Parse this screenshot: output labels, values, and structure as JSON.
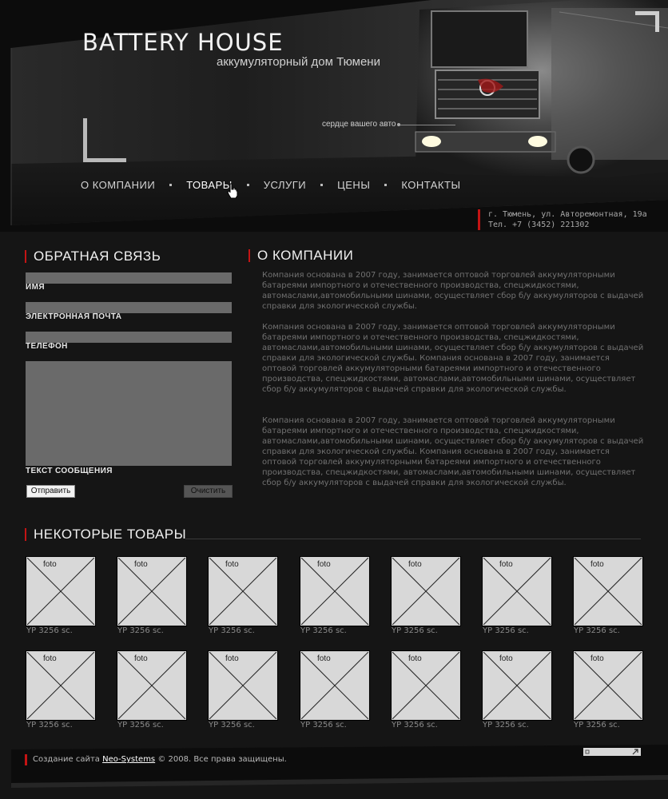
{
  "header": {
    "brand_title": "BATTERY HOUSE",
    "brand_subtitle": "аккумуляторный дом Тюмени",
    "heart_label": "сердце вашего авто"
  },
  "nav": {
    "items": [
      {
        "label": "О КОМПАНИИ",
        "active": false
      },
      {
        "label": "ТОВАРЫ",
        "active": true
      },
      {
        "label": "УСЛУГИ",
        "active": false
      },
      {
        "label": "ЦЕНЫ",
        "active": false
      },
      {
        "label": "КОНТАКТЫ",
        "active": false
      }
    ]
  },
  "contact": {
    "address": "г. Тюмень, ул. Авторемонтная, 19а",
    "phone": "Тел. +7 (3452) 221302"
  },
  "feedback": {
    "heading": "ОБРАТНАЯ СВЯЗЬ",
    "name_label": "ИМЯ",
    "email_label": "ЭЛЕКТРОННАЯ ПОЧТА",
    "phone_label": "ТЕЛЕФОН",
    "message_label": "ТЕКСТ СООБЩЕНИЯ",
    "submit_label": "Отправить",
    "clear_label": "Очистить"
  },
  "about": {
    "heading": "О КОМПАНИИ",
    "paragraphs": [
      "Компания основана в 2007 году, занимается оптовой торговлей аккумуляторными батареями импортного и отечественного производства, спецжидкостями, автомаслами,автомобильными шинами, осуществляет сбор б/у аккумуляторов с выдачей справки для экологической службы.",
      "Компания основана в 2007 году, занимается оптовой торговлей аккумуляторными батареями импортного и отечественного производства, спецжидкостями, автомаслами,автомобильными шинами, осуществляет сбор б/у аккумуляторов с выдачей справки для экологической службы. Компания основана в 2007 году, занимается оптовой торговлей аккумуляторными батареями импортного и отечественного производства, спецжидкостями, автомаслами,автомобильными шинами, осуществляет сбор б/у аккумуляторов с выдачей справки для экологической службы.",
      "Компания основана в 2007 году, занимается оптовой торговлей аккумуляторными батареями импортного и отечественного производства, спецжидкостями, автомаслами,автомобильными шинами, осуществляет сбор б/у аккумуляторов с выдачей справки для экологической службы. Компания основана в 2007 году, занимается оптовой торговлей аккумуляторными батареями импортного и отечественного производства, спецжидкостями, автомаслами,автомобильными шинами, осуществляет сбор б/у аккумуляторов с выдачей справки для экологической службы."
    ]
  },
  "products": {
    "heading": "НЕКОТОРЫЕ ТОВАРЫ",
    "photo_placeholder": "foto",
    "items": [
      "YP 3256 sc.",
      "YP 3256 sc.",
      "YP 3256 sc.",
      "YP 3256 sc.",
      "YP 3256 sc.",
      "YP 3256 sc.",
      "YP 3256 sc.",
      "YP 3256 sc.",
      "YP 3256 sc.",
      "YP 3256 sc.",
      "YP 3256 sc.",
      "YP 3256 sc.",
      "YP 3256 sc.",
      "YP 3256 sc."
    ]
  },
  "footer": {
    "prefix": "Создание сайта",
    "link": "Neo-Systems",
    "suffix": "© 2008. Все права защищены."
  }
}
